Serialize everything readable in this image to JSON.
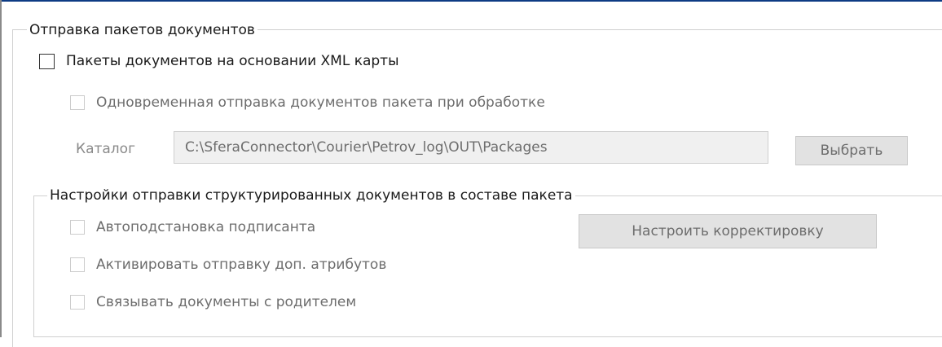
{
  "group_main": {
    "legend": "Отправка пакетов документов",
    "xml_packages": {
      "label": "Пакеты документов на основании XML карты",
      "checked": false,
      "enabled": true
    },
    "simultaneous_send": {
      "label": "Одновременная отправка документов пакета при обработке",
      "checked": false,
      "enabled": false
    },
    "catalog": {
      "label": "Каталог",
      "value": "C:\\SferaConnector\\Courier\\Petrov_log\\OUT\\Packages",
      "browse_button": "Выбрать"
    }
  },
  "group_structured": {
    "legend": "Настройки отправки структурированных документов в составе пакета",
    "auto_signer": {
      "label": "Автоподстановка подписанта",
      "checked": false,
      "enabled": false
    },
    "extra_attributes": {
      "label": "Активировать отправку доп. атрибутов",
      "checked": false,
      "enabled": false
    },
    "link_parent": {
      "label": "Связывать документы с родителем",
      "checked": false,
      "enabled": false
    },
    "configure_button": "Настроить корректировку"
  }
}
